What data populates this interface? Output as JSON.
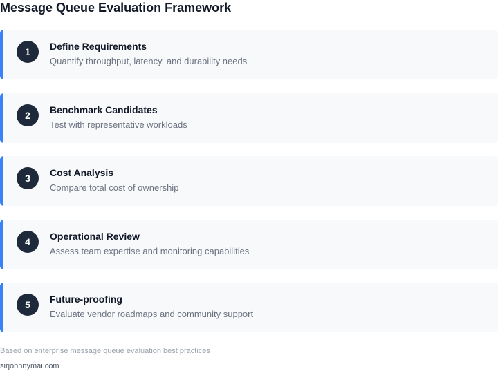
{
  "title": "Message Queue Evaluation Framework",
  "steps": [
    {
      "number": "1",
      "title": "Define Requirements",
      "description": "Quantify throughput, latency, and durability needs"
    },
    {
      "number": "2",
      "title": "Benchmark Candidates",
      "description": "Test with representative workloads"
    },
    {
      "number": "3",
      "title": "Cost Analysis",
      "description": "Compare total cost of ownership"
    },
    {
      "number": "4",
      "title": "Operational Review",
      "description": "Assess team expertise and monitoring capabilities"
    },
    {
      "number": "5",
      "title": "Future-proofing",
      "description": "Evaluate vendor roadmaps and community support"
    }
  ],
  "footer": {
    "note": "Based on enterprise message queue evaluation best practices",
    "site": "sirjohnnymai.com"
  },
  "colors": {
    "accent": "#3b82f6",
    "badge": "#1e293b",
    "card": "#f8f9fb"
  }
}
